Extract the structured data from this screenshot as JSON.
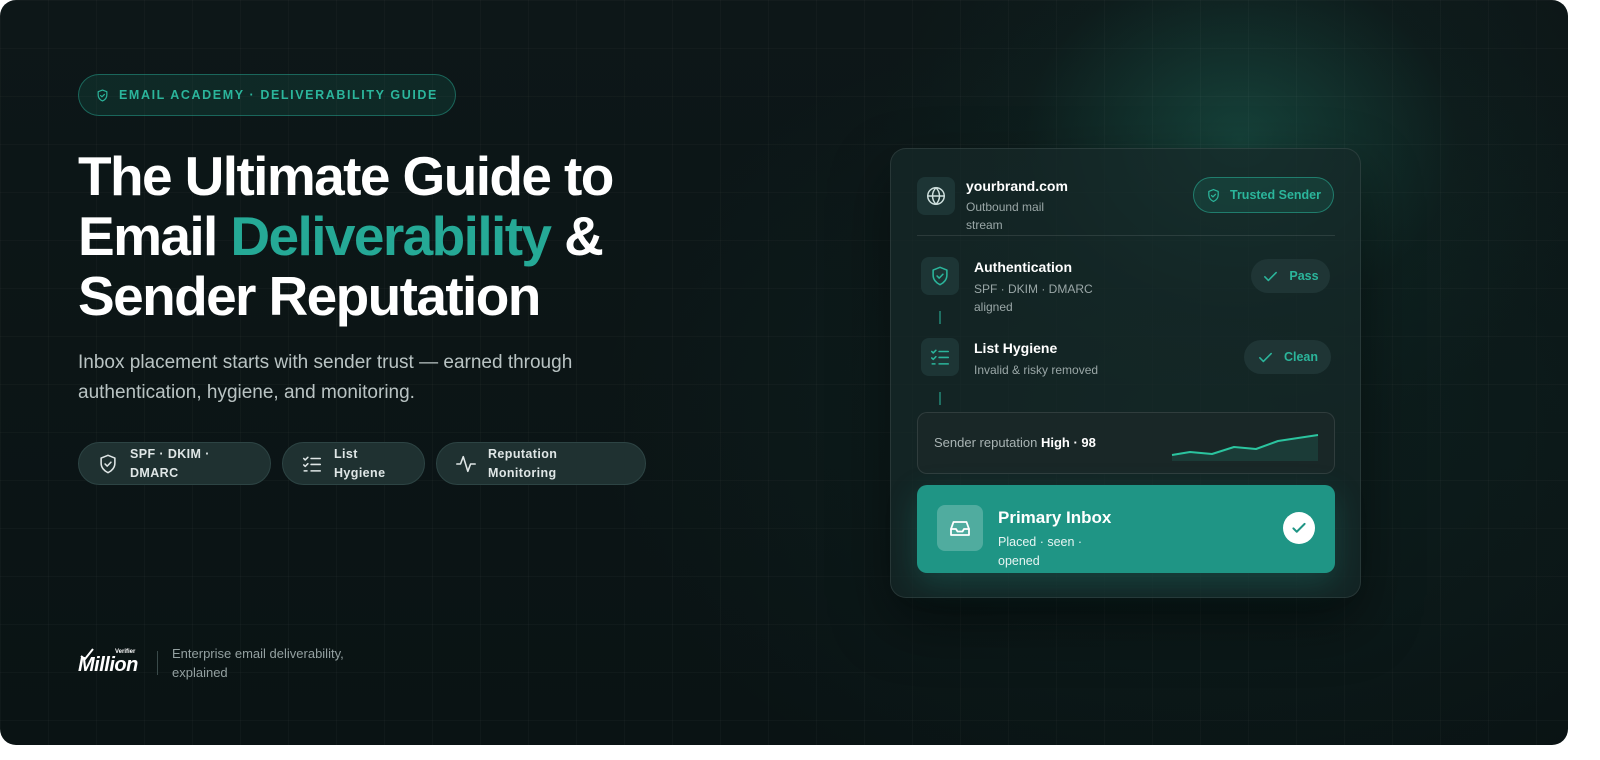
{
  "badge": {
    "text": "EMAIL ACADEMY · DELIVERABILITY GUIDE",
    "icon": "shield-check-icon"
  },
  "headline": {
    "line1": "The Ultimate Guide to",
    "line2_pre": "Email ",
    "line2_accent": "Deliverability",
    "line2_post": " &",
    "line3": "Sender Reputation"
  },
  "subtitle": "Inbox placement starts with sender trust — earned through authentication, hygiene, and monitoring.",
  "chips": [
    {
      "label": "SPF · DKIM · DMARC",
      "icon": "shield-check-icon"
    },
    {
      "label": "List Hygiene",
      "icon": "checklist-icon"
    },
    {
      "label": "Reputation Monitoring",
      "icon": "activity-icon"
    }
  ],
  "footer": {
    "logo_word": "Million",
    "logo_small": "Verifier",
    "tagline": "Enterprise email deliverability, explained"
  },
  "card": {
    "domain": "yourbrand.com",
    "domain_sub": "Outbound mail stream",
    "trusted_label": "Trusted Sender",
    "steps": [
      {
        "title": "Authentication",
        "sub": "SPF · DKIM · DMARC aligned",
        "status": "Pass",
        "icon": "shield-check-icon"
      },
      {
        "title": "List Hygiene",
        "sub": "Invalid & risky removed",
        "status": "Clean",
        "icon": "checklist-icon"
      }
    ],
    "reputation": {
      "label": "Sender reputation ",
      "value": "High · 98"
    },
    "inbox": {
      "title": "Primary Inbox",
      "sub": "Placed · seen · opened"
    }
  },
  "colors": {
    "accent": "#25a996",
    "background": "#0d1718",
    "inbox": "#1f9585"
  }
}
